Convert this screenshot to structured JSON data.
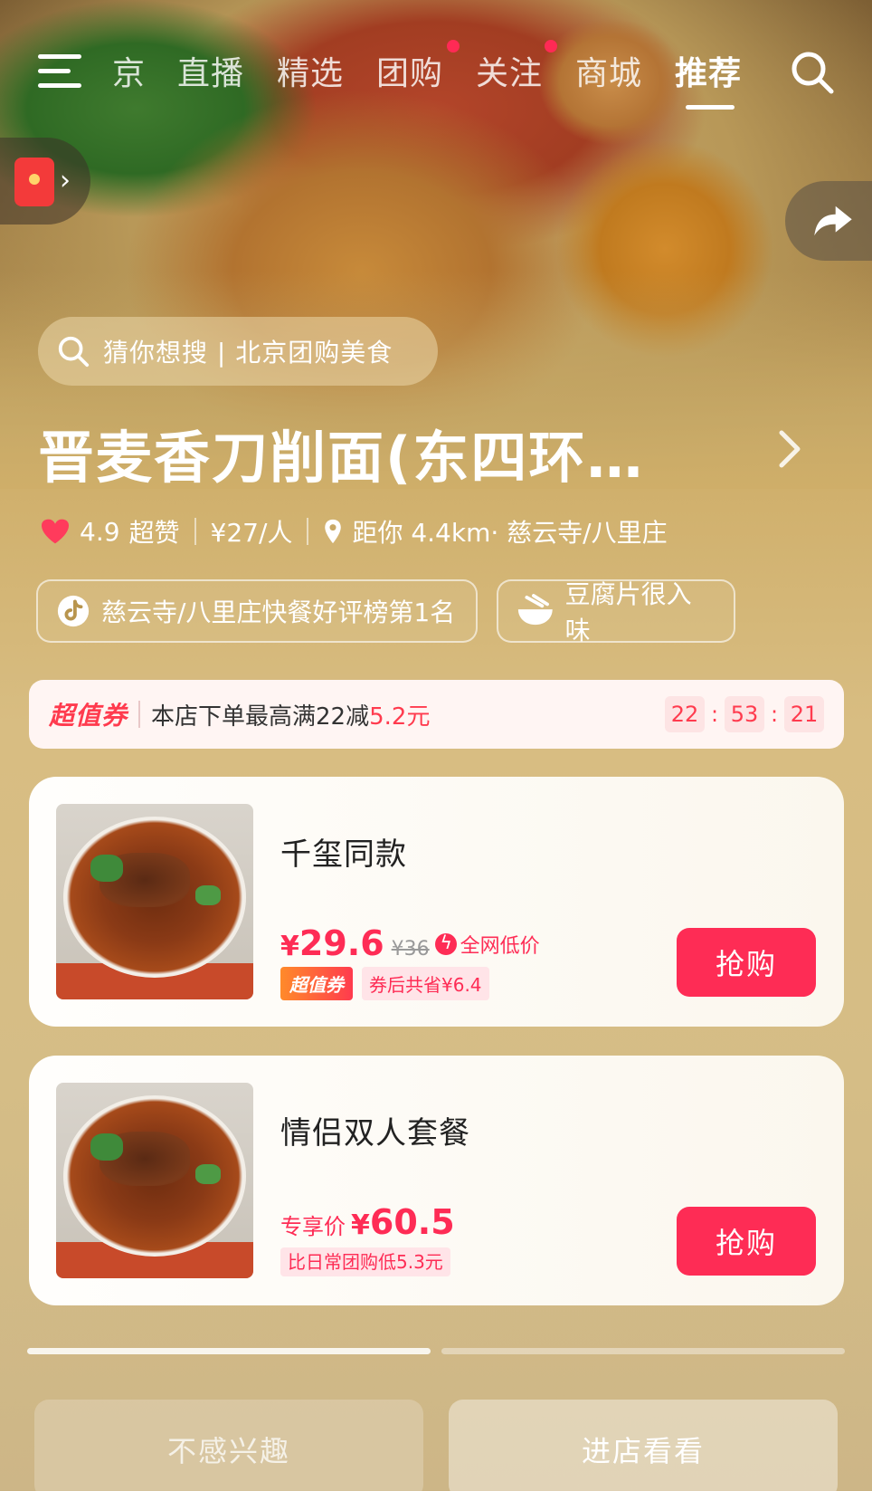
{
  "nav": {
    "tabs": [
      {
        "label": "京"
      },
      {
        "label": "直播"
      },
      {
        "label": "精选"
      },
      {
        "label": "团购"
      },
      {
        "label": "关注"
      },
      {
        "label": "商城"
      },
      {
        "label": "推荐"
      }
    ],
    "active_tab": "推荐"
  },
  "search_suggestion": "猜你想搜 | 北京团购美食",
  "shop": {
    "title": "晋麦香刀削面(东四环…",
    "rating": "4.9",
    "rating_label": "超赞",
    "per_person": "¥27/人",
    "distance": "距你 4.4km· 慈云寺/八里庄"
  },
  "tags": [
    {
      "text": "慈云寺/八里庄快餐好评榜第1名",
      "icon": "ranking-icon"
    },
    {
      "text": "豆腐片很入味",
      "icon": "bowl-icon"
    }
  ],
  "coupon": {
    "logo": "超值券",
    "text_prefix": "本店下单最高满22减",
    "text_highlight": "5.2元",
    "timer": {
      "h": "22",
      "m": "53",
      "s": "21"
    }
  },
  "products": [
    {
      "name": "千玺同款",
      "currency": "¥",
      "price": "29.6",
      "original_price": "¥36",
      "low_price_label": "全网低价",
      "badge": "超值券",
      "saving": "券后共省¥6.4",
      "buy_label": "抢购"
    },
    {
      "name": "情侣双人套餐",
      "exclusive_label": "专享价",
      "currency": "¥",
      "price": "60.5",
      "saving": "比日常团购低5.3元",
      "buy_label": "抢购"
    }
  ],
  "actions": {
    "uninterested": "不感兴趣",
    "enter_shop": "进店看看"
  },
  "colors": {
    "accent": "#fe2c55",
    "background": "#cfae69"
  }
}
